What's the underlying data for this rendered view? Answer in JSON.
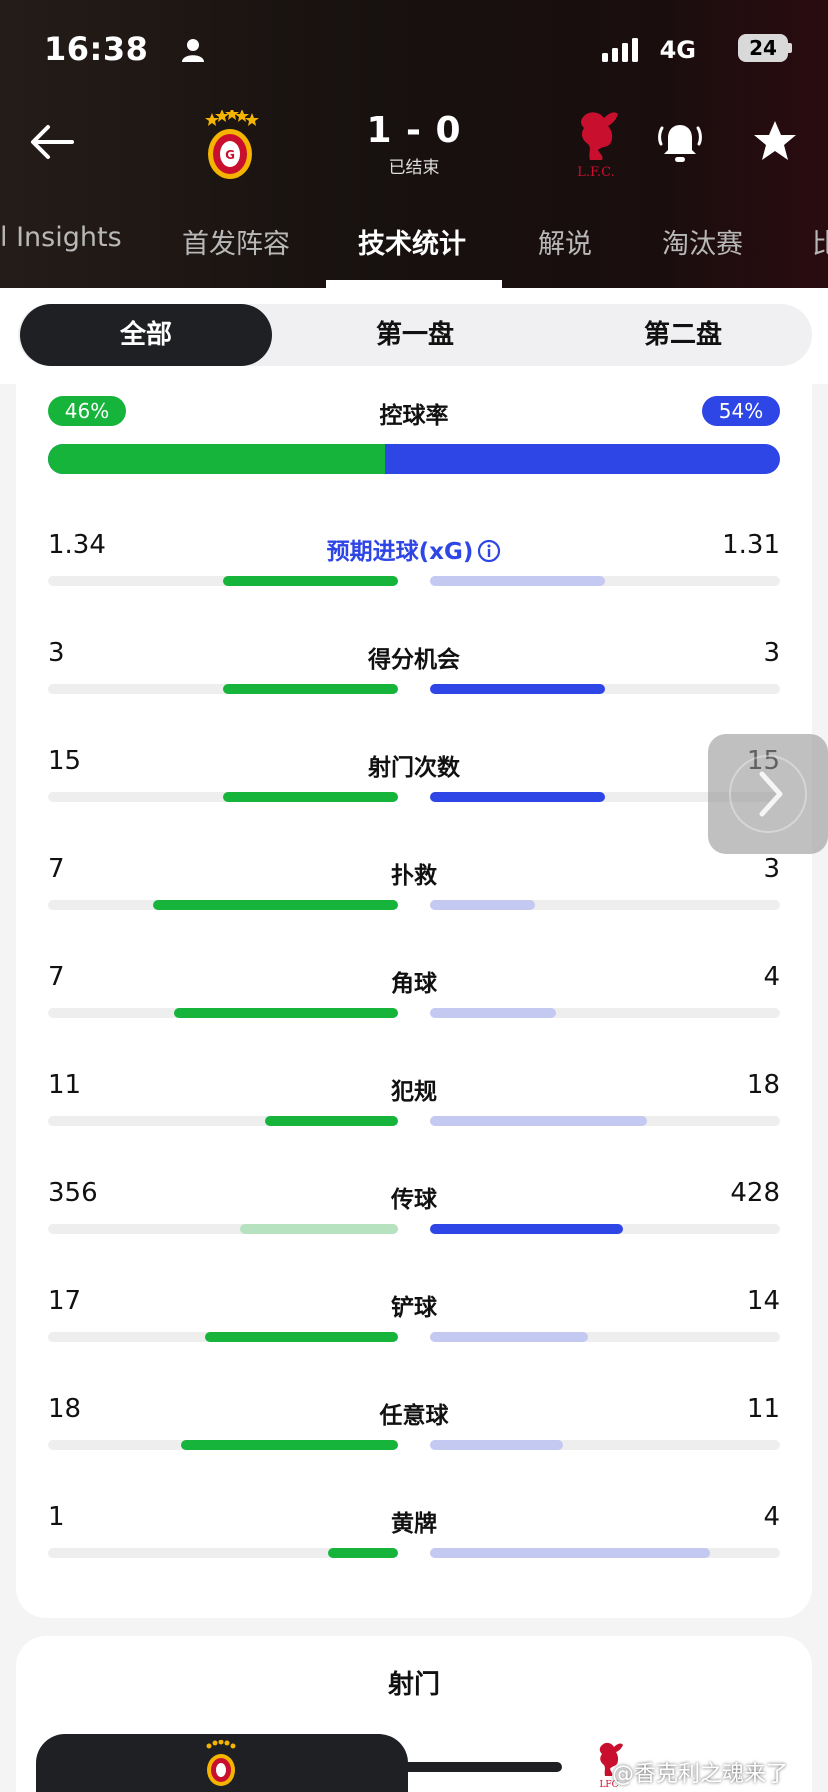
{
  "status_bar": {
    "time": "16:38",
    "network": "4G",
    "battery": "24"
  },
  "match": {
    "score": "1 - 0",
    "state": "已结束",
    "home_logo": "galatasaray-crest",
    "away_logo": "liverpool-crest"
  },
  "tabs": [
    {
      "label": "l Insights"
    },
    {
      "label": "首发阵容"
    },
    {
      "label": "技术统计",
      "active": true
    },
    {
      "label": "解说"
    },
    {
      "label": "淘汰赛"
    },
    {
      "label": "比"
    }
  ],
  "segments": [
    {
      "label": "全部",
      "active": true
    },
    {
      "label": "第一盘"
    },
    {
      "label": "第二盘"
    }
  ],
  "possession": {
    "label": "控球率",
    "home": "46%",
    "away": "54%",
    "home_fraction": 0.46
  },
  "stats": [
    {
      "label": "预期进球(xG)",
      "home": "1.34",
      "away": "1.31",
      "home_fill": 0.5,
      "away_fill": 0.5,
      "home_color": "#16b43a",
      "away_color": "#c3c9f0",
      "link": true
    },
    {
      "label": "得分机会",
      "home": "3",
      "away": "3",
      "home_fill": 0.5,
      "away_fill": 0.5,
      "home_color": "#16b43a",
      "away_color": "#2f46e6"
    },
    {
      "label": "射门次数",
      "home": "15",
      "away": "15",
      "home_fill": 0.5,
      "away_fill": 0.5,
      "home_color": "#16b43a",
      "away_color": "#2f46e6"
    },
    {
      "label": "扑救",
      "home": "7",
      "away": "3",
      "home_fill": 0.7,
      "away_fill": 0.3,
      "home_color": "#16b43a",
      "away_color": "#c3c9f0"
    },
    {
      "label": "角球",
      "home": "7",
      "away": "4",
      "home_fill": 0.64,
      "away_fill": 0.36,
      "home_color": "#16b43a",
      "away_color": "#c3c9f0"
    },
    {
      "label": "犯规",
      "home": "11",
      "away": "18",
      "home_fill": 0.38,
      "away_fill": 0.62,
      "home_color": "#16b43a",
      "away_color": "#c3c9f0"
    },
    {
      "label": "传球",
      "home": "356",
      "away": "428",
      "home_fill": 0.45,
      "away_fill": 0.55,
      "home_color": "#b7e2c0",
      "away_color": "#2f46e6"
    },
    {
      "label": "铲球",
      "home": "17",
      "away": "14",
      "home_fill": 0.55,
      "away_fill": 0.45,
      "home_color": "#16b43a",
      "away_color": "#c3c9f0"
    },
    {
      "label": "任意球",
      "home": "18",
      "away": "11",
      "home_fill": 0.62,
      "away_fill": 0.38,
      "home_color": "#16b43a",
      "away_color": "#c3c9f0"
    },
    {
      "label": "黄牌",
      "home": "1",
      "away": "4",
      "home_fill": 0.2,
      "away_fill": 0.8,
      "home_color": "#16b43a",
      "away_color": "#c3c9f0"
    }
  ],
  "shots_section": {
    "title": "射门"
  },
  "watermark": "@香克利之魂来了"
}
